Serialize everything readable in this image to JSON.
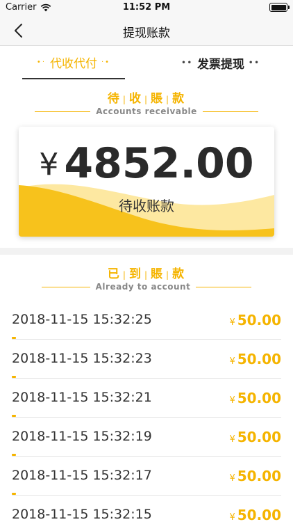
{
  "status_bar": {
    "carrier": "Carrier",
    "time": "11:52 PM"
  },
  "nav": {
    "title": "提现账款"
  },
  "tabs": [
    {
      "label": "代收代付",
      "active": true
    },
    {
      "label": "发票提现",
      "active": false
    }
  ],
  "receivable": {
    "title_chars": [
      "待",
      "收",
      "賬",
      "款"
    ],
    "subtitle": "Accounts receivable",
    "currency": "¥",
    "amount": "4852.00",
    "label": "待收账款"
  },
  "arrived": {
    "title_chars": [
      "已",
      "到",
      "賬",
      "款"
    ],
    "subtitle": "Already to account"
  },
  "records": [
    {
      "date": "2018-11-15 15:32:25",
      "currency": "¥",
      "amount": "50.00"
    },
    {
      "date": "2018-11-15 15:32:23",
      "currency": "¥",
      "amount": "50.00"
    },
    {
      "date": "2018-11-15 15:32:21",
      "currency": "¥",
      "amount": "50.00"
    },
    {
      "date": "2018-11-15 15:32:19",
      "currency": "¥",
      "amount": "50.00"
    },
    {
      "date": "2018-11-15 15:32:17",
      "currency": "¥",
      "amount": "50.00"
    },
    {
      "date": "2018-11-15 15:32:15",
      "currency": "¥",
      "amount": "50.00"
    }
  ],
  "colors": {
    "accent": "#f5b400",
    "text": "#333333"
  }
}
